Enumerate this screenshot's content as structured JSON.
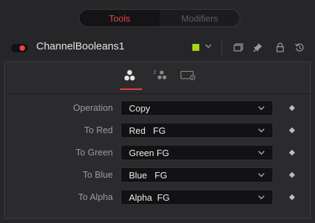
{
  "top_tabs": [
    {
      "label": "Tools",
      "active": true
    },
    {
      "label": "Modifiers",
      "active": false
    }
  ],
  "node": {
    "title": "ChannelBooleans1",
    "enabled_color": "#e8463a",
    "color_swatch": "#a6d616",
    "header_icons": [
      "color-dropdown-chevron-icon",
      "versions-icon",
      "pin-icon",
      "lock-icon",
      "reset-icon"
    ]
  },
  "inspector_tabs": [
    {
      "name": "channels-tab",
      "icon": "channel-circles-icon",
      "active": true
    },
    {
      "name": "zdepth-tab",
      "icon": "z-depth-icon",
      "active": false
    },
    {
      "name": "settings-tab",
      "icon": "settings-gear-icon",
      "active": false
    }
  ],
  "controls": [
    {
      "label": "Operation",
      "value": "Copy"
    },
    {
      "label": "To Red",
      "value": "Red   FG"
    },
    {
      "label": "To Green",
      "value": "Green FG"
    },
    {
      "label": "To Blue",
      "value": "Blue   FG"
    },
    {
      "label": "To Alpha",
      "value": "Alpha  FG"
    }
  ]
}
